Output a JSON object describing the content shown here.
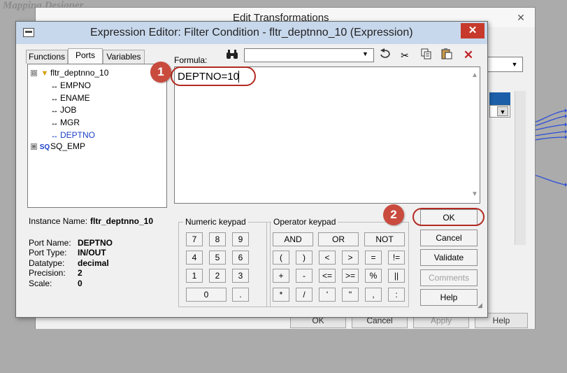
{
  "background": {
    "caption": "Mapping Designer",
    "window_title": "Edit Transformations",
    "close_glyph": "✕",
    "bottom_buttons": [
      "OK",
      "Cancel",
      "Apply",
      "Help"
    ]
  },
  "dialog": {
    "title": "Expression Editor: Filter Condition - fltr_deptnno_10 (Expression)",
    "close_glyph": "✕",
    "tabs": [
      {
        "label": "Functions",
        "active": false
      },
      {
        "label": "Ports",
        "active": true
      },
      {
        "label": "Variables",
        "active": false
      }
    ],
    "tree": {
      "root": {
        "label": "fltr_deptnno_10",
        "icon": "filter-funnel-icon",
        "expander": "⊟"
      },
      "ports": [
        {
          "label": "EMPNO",
          "selected": false
        },
        {
          "label": "ENAME",
          "selected": false
        },
        {
          "label": "JOB",
          "selected": false
        },
        {
          "label": "MGR",
          "selected": false
        },
        {
          "label": "DEPTNO",
          "selected": true
        }
      ],
      "port_glyph": "↔",
      "source": {
        "label": "SQ_EMP",
        "icon_text": "SQ",
        "expander": "⊞"
      }
    },
    "instance": {
      "label": "Instance Name:",
      "value": "fltr_deptnno_10"
    },
    "port_info": [
      {
        "label": "Port Name:",
        "value": "DEPTNO"
      },
      {
        "label": "Port Type:",
        "value": "IN/OUT"
      },
      {
        "label": "Datatype:",
        "value": "decimal"
      },
      {
        "label": "Precision:",
        "value": "2"
      },
      {
        "label": "Scale:",
        "value": "0"
      }
    ],
    "formula": {
      "label": "Formula:",
      "text": "DEPTNO=10",
      "combo_value": ""
    },
    "toolbar_icons": {
      "find": "binoculars-icon",
      "undo": "undo-icon",
      "cut": "scissors-icon",
      "copy": "copy-icon",
      "paste": "paste-icon",
      "delete": "delete-x-icon"
    },
    "numeric_keypad": {
      "title": "Numeric keypad",
      "rows": [
        [
          "7",
          "8",
          "9"
        ],
        [
          "4",
          "5",
          "6"
        ],
        [
          "1",
          "2",
          "3"
        ]
      ],
      "zero": "0",
      "dot": "."
    },
    "operator_keypad": {
      "title": "Operator keypad",
      "logic": [
        "AND",
        "OR",
        "NOT"
      ],
      "rows": [
        [
          "(",
          ")",
          "<",
          ">",
          "=",
          "!="
        ],
        [
          "+",
          "-",
          "<=",
          ">=",
          "%",
          "||"
        ],
        [
          "*",
          "/",
          "'",
          "\"",
          ",",
          ":"
        ]
      ]
    },
    "buttons": [
      {
        "label": "OK",
        "enabled": true
      },
      {
        "label": "Cancel",
        "enabled": true
      },
      {
        "label": "Validate",
        "enabled": true
      },
      {
        "label": "Comments",
        "enabled": false
      },
      {
        "label": "Help",
        "enabled": true
      }
    ]
  },
  "annotations": [
    {
      "number": "1",
      "target": "formula-text"
    },
    {
      "number": "2",
      "target": "ok-button"
    }
  ],
  "colors": {
    "accent": "#c94b3e",
    "selection": "#1a3fc8",
    "title_close": "#c73a2b"
  }
}
